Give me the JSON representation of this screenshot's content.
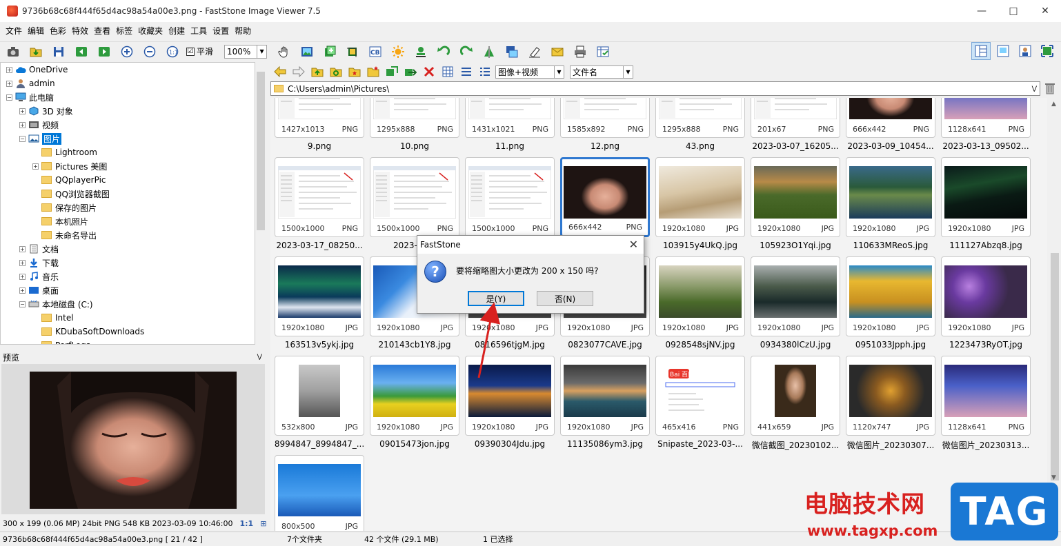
{
  "window": {
    "title": "9736b68c68f444f65d4ac98a54a00e3.png  -  FastStone Image Viewer 7.5"
  },
  "menu": [
    "文件",
    "编辑",
    "色彩",
    "特效",
    "查看",
    "标签",
    "收藏夹",
    "创建",
    "工具",
    "设置",
    "帮助"
  ],
  "toolbar": {
    "smooth_label": "平滑",
    "smooth_checked": "☑",
    "zoom": "100%"
  },
  "tree": [
    {
      "label": "OneDrive",
      "level": 0,
      "icon": "cloud-icon"
    },
    {
      "label": "admin",
      "level": 0,
      "icon": "user-icon"
    },
    {
      "label": "此电脑",
      "level": 0,
      "icon": "computer-icon"
    },
    {
      "label": "3D 对象",
      "level": 1,
      "icon": "cube-icon"
    },
    {
      "label": "视频",
      "level": 1,
      "icon": "video-icon"
    },
    {
      "label": "图片",
      "level": 1,
      "icon": "pictures-icon",
      "selected": true
    },
    {
      "label": "Lightroom",
      "level": 2,
      "icon": "folder-icon"
    },
    {
      "label": "Pictures 美图",
      "level": 2,
      "icon": "folder-icon"
    },
    {
      "label": "QQplayerPic",
      "level": 2,
      "icon": "folder-icon"
    },
    {
      "label": "QQ浏览器截图",
      "level": 2,
      "icon": "folder-icon"
    },
    {
      "label": "保存的图片",
      "level": 2,
      "icon": "folder-icon"
    },
    {
      "label": "本机照片",
      "level": 2,
      "icon": "folder-icon"
    },
    {
      "label": "未命名导出",
      "level": 2,
      "icon": "folder-icon"
    },
    {
      "label": "文档",
      "level": 1,
      "icon": "document-icon"
    },
    {
      "label": "下载",
      "level": 1,
      "icon": "download-icon"
    },
    {
      "label": "音乐",
      "level": 1,
      "icon": "music-icon"
    },
    {
      "label": "桌面",
      "level": 1,
      "icon": "desktop-icon"
    },
    {
      "label": "本地磁盘 (C:)",
      "level": 1,
      "icon": "drive-icon"
    },
    {
      "label": "Intel",
      "level": 2,
      "icon": "folder-icon"
    },
    {
      "label": "KDubaSoftDownloads",
      "level": 2,
      "icon": "folder-icon"
    },
    {
      "label": "PerfLogs",
      "level": 2,
      "icon": "folder-icon"
    }
  ],
  "preview": {
    "label": "预览",
    "info": "300 x 199 (0.06 MP)  24bit  PNG    548 KB   2023-03-09 10:46:00",
    "ratio": "1:1"
  },
  "filter": {
    "type": "图像+视频",
    "sort": "文件名"
  },
  "address": "C:\\Users\\admin\\Pictures\\",
  "thumbnails": [
    {
      "dim": "1427x1013",
      "ext": "PNG",
      "name": "9.png",
      "style": "screen"
    },
    {
      "dim": "1295x888",
      "ext": "PNG",
      "name": "10.png",
      "style": "screen"
    },
    {
      "dim": "1431x1021",
      "ext": "PNG",
      "name": "11.png",
      "style": "screen"
    },
    {
      "dim": "1585x892",
      "ext": "PNG",
      "name": "12.png",
      "style": "screen"
    },
    {
      "dim": "1295x888",
      "ext": "PNG",
      "name": "43.png",
      "style": "screen"
    },
    {
      "dim": "201x67",
      "ext": "PNG",
      "name": "2023-03-07_16205...",
      "style": "screen"
    },
    {
      "dim": "666x442",
      "ext": "PNG",
      "name": "2023-03-09_10454...",
      "style": "face"
    },
    {
      "dim": "1128x641",
      "ext": "PNG",
      "name": "2023-03-13_09502...",
      "style": "anime"
    },
    {
      "dim": "1500x1000",
      "ext": "PNG",
      "name": "2023-03-17_08250...",
      "style": "screen"
    },
    {
      "dim": "1500x1000",
      "ext": "PNG",
      "name": "2023-03-2",
      "style": "screen"
    },
    {
      "dim": "1500x1000",
      "ext": "PNG",
      "name": "",
      "style": "screen"
    },
    {
      "dim": "666x442",
      "ext": "PNG",
      "name": "",
      "style": "face",
      "selected": true
    },
    {
      "dim": "1920x1080",
      "ext": "JPG",
      "name": "103915y4UkQ.jpg",
      "style": "desert"
    },
    {
      "dim": "1920x1080",
      "ext": "JPG",
      "name": "105923O1Yqi.jpg",
      "style": "meadow"
    },
    {
      "dim": "1920x1080",
      "ext": "JPG",
      "name": "110633MReoS.jpg",
      "style": "lake"
    },
    {
      "dim": "1920x1080",
      "ext": "JPG",
      "name": "111127Abzq8.jpg",
      "style": "aurora"
    },
    {
      "dim": "1920x1080",
      "ext": "JPG",
      "name": "163513v5ykj.jpg",
      "style": "aurora2"
    },
    {
      "dim": "1920x1080",
      "ext": "JPG",
      "name": "210143cb1Y8.jpg",
      "style": "clouds"
    },
    {
      "dim": "1920x1080",
      "ext": "JPG",
      "name": "0816596tjgM.jpg",
      "style": "dark"
    },
    {
      "dim": "1920x1080",
      "ext": "JPG",
      "name": "0823077CAVE.jpg",
      "style": "dark"
    },
    {
      "dim": "1920x1080",
      "ext": "JPG",
      "name": "0928548sjNV.jpg",
      "style": "valley"
    },
    {
      "dim": "1920x1080",
      "ext": "JPG",
      "name": "0934380lCzU.jpg",
      "style": "river"
    },
    {
      "dim": "1920x1080",
      "ext": "JPG",
      "name": "0951033Jpph.jpg",
      "style": "yellow"
    },
    {
      "dim": "1920x1080",
      "ext": "JPG",
      "name": "1223473RyOT.jpg",
      "style": "flowers"
    },
    {
      "dim": "532x800",
      "ext": "JPG",
      "name": "8994847_8994847_...",
      "style": "person"
    },
    {
      "dim": "1920x1080",
      "ext": "JPG",
      "name": "09015473jon.jpg",
      "style": "field"
    },
    {
      "dim": "1920x1080",
      "ext": "JPG",
      "name": "09390304Jdu.jpg",
      "style": "city"
    },
    {
      "dim": "1920x1080",
      "ext": "JPG",
      "name": "11135086ym3.jpg",
      "style": "sea"
    },
    {
      "dim": "465x416",
      "ext": "PNG",
      "name": "Snipaste_2023-03-...",
      "style": "baidu"
    },
    {
      "dim": "441x659",
      "ext": "JPG",
      "name": "微信截图_20230102...",
      "style": "portrait"
    },
    {
      "dim": "1120x747",
      "ext": "JPG",
      "name": "微信图片_20230307...",
      "style": "autumn"
    },
    {
      "dim": "1128x641",
      "ext": "PNG",
      "name": "微信图片_20230313...",
      "style": "anime"
    },
    {
      "dim": "800x500",
      "ext": "JPG",
      "name": "",
      "style": "dog"
    }
  ],
  "thumb_labels": {
    "baidu": "Bai 百度"
  },
  "status": {
    "file": "9736b68c68f444f65d4ac98a54a00e3.png [ 21 / 42 ]",
    "folders": "7个文件夹",
    "files": "42 个文件 (29.1 MB)",
    "selected": "1 已选择"
  },
  "dialog": {
    "title": "FastStone",
    "message": "要将缩略图大小更改为 200 x 150 吗?",
    "yes": "是(Y)",
    "no": "否(N)",
    "icon": "question-icon"
  },
  "watermark": {
    "text": "电脑技术网",
    "url": "www.tagxp.com",
    "tag": "TAG"
  },
  "colors": {
    "selection": "#0078d7",
    "tile_selected": "#2f78d0",
    "arrow": "#d8211f"
  }
}
